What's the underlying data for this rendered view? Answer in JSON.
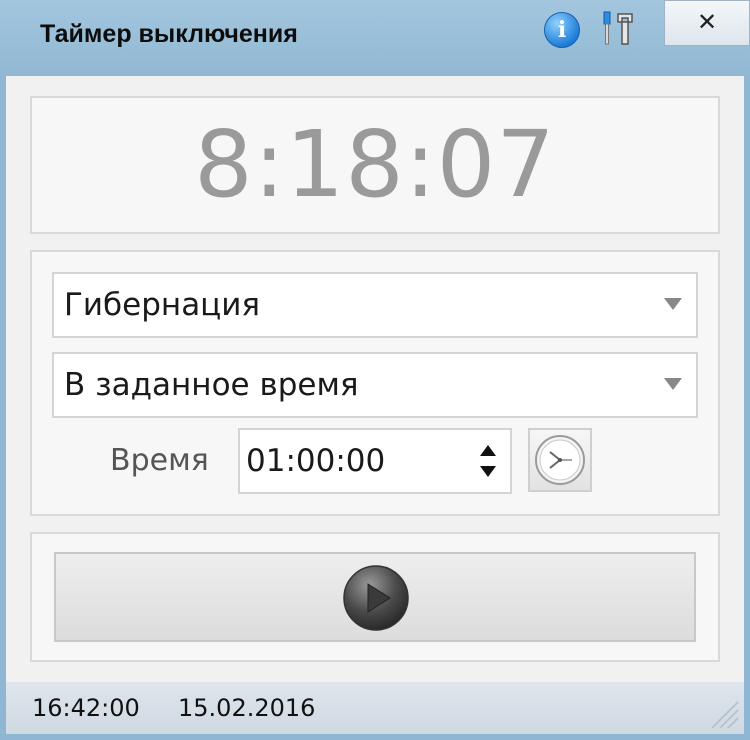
{
  "window": {
    "title": "Таймер выключения",
    "info_label": "i",
    "close_label": "✕"
  },
  "clock": {
    "display": "8:18:07"
  },
  "controls": {
    "action_selected": "Гибернация",
    "mode_selected": "В заданное время",
    "time_label": "Время",
    "time_value": "01:00:00"
  },
  "status": {
    "time": "16:42:00",
    "date": "15.02.2016"
  },
  "icons": {
    "info": "info-icon",
    "tools": "tools-icon",
    "close": "close-icon",
    "dropdown": "chevron-down-icon",
    "spin": "spinner-icon",
    "clock": "clock-icon",
    "play": "play-icon",
    "grip": "resize-grip-icon"
  },
  "colors": {
    "titlebar": "#91b8d3",
    "clock_text": "#9a9a9a",
    "info_blue": "#1f7ed8"
  }
}
